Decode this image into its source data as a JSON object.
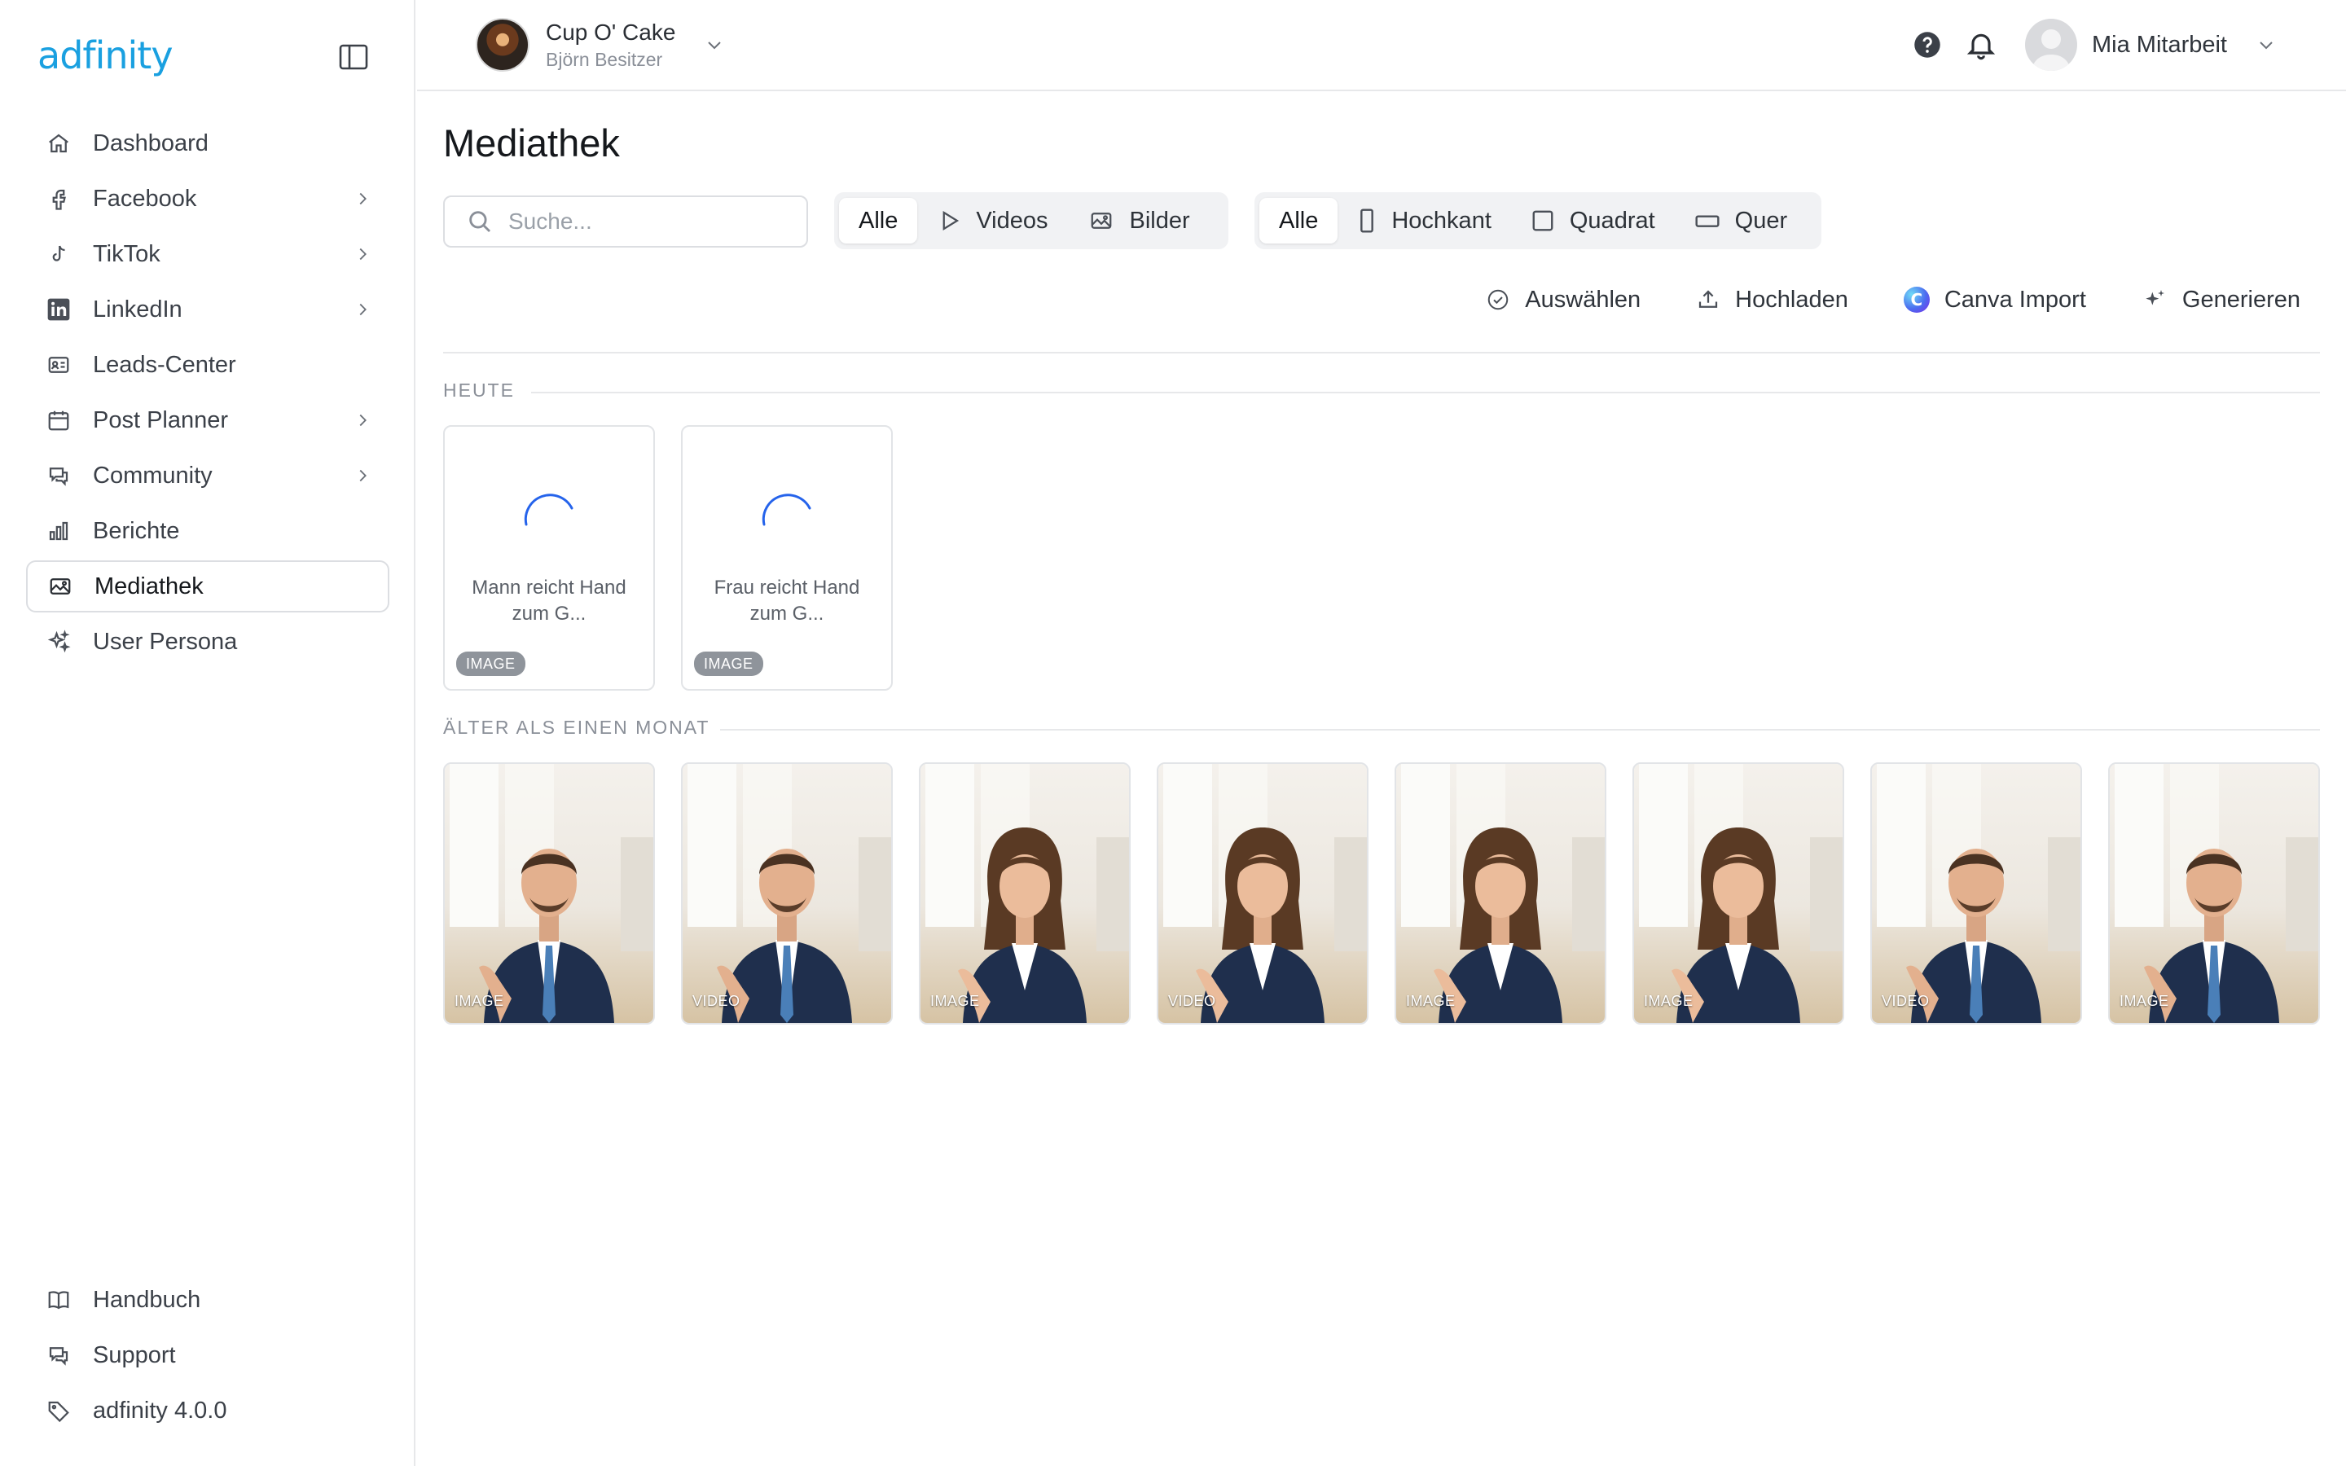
{
  "app": {
    "logo_text": "adfinity"
  },
  "sidebar": {
    "items": [
      {
        "label": "Dashboard",
        "icon": "home-icon",
        "has_submenu": false
      },
      {
        "label": "Facebook",
        "icon": "facebook-icon",
        "has_submenu": true
      },
      {
        "label": "TikTok",
        "icon": "tiktok-icon",
        "has_submenu": true
      },
      {
        "label": "LinkedIn",
        "icon": "linkedin-icon",
        "has_submenu": true
      },
      {
        "label": "Leads-Center",
        "icon": "contact-card-icon",
        "has_submenu": false
      },
      {
        "label": "Post Planner",
        "icon": "calendar-icon",
        "has_submenu": true
      },
      {
        "label": "Community",
        "icon": "chat-icon",
        "has_submenu": true
      },
      {
        "label": "Berichte",
        "icon": "bar-chart-icon",
        "has_submenu": false
      },
      {
        "label": "Mediathek",
        "icon": "image-icon",
        "has_submenu": false,
        "active": true
      },
      {
        "label": "User Persona",
        "icon": "sparkles-icon",
        "has_submenu": false
      }
    ],
    "bottom_items": [
      {
        "label": "Handbuch",
        "icon": "book-icon"
      },
      {
        "label": "Support",
        "icon": "chat-icon"
      },
      {
        "label": "adfinity 4.0.0",
        "icon": "tag-icon"
      }
    ]
  },
  "topbar": {
    "account_name": "Cup O' Cake",
    "account_owner": "Björn Besitzer",
    "user_name": "Mia Mitarbeit"
  },
  "main": {
    "title": "Mediathek",
    "search": {
      "placeholder": "Suche...",
      "value": ""
    },
    "type_filter": {
      "options": [
        "Alle",
        "Videos",
        "Bilder"
      ],
      "selected": "Alle"
    },
    "format_filter": {
      "options": [
        "Alle",
        "Hochkant",
        "Quadrat",
        "Quer"
      ],
      "selected": "Alle"
    },
    "actions": [
      "Auswählen",
      "Hochladen",
      "Canva Import",
      "Generieren"
    ],
    "sections": [
      {
        "label": "HEUTE",
        "items": [
          {
            "caption": "Mann reicht Hand zum G...",
            "type": "IMAGE",
            "loading": true
          },
          {
            "caption": "Frau reicht Hand zum G...",
            "type": "IMAGE",
            "loading": true
          }
        ]
      },
      {
        "label": "ÄLTER ALS EINEN MONAT",
        "items": [
          {
            "type": "IMAGE",
            "subject": "man"
          },
          {
            "type": "VIDEO",
            "subject": "man"
          },
          {
            "type": "IMAGE",
            "subject": "woman"
          },
          {
            "type": "VIDEO",
            "subject": "woman"
          },
          {
            "type": "IMAGE",
            "subject": "woman"
          },
          {
            "type": "IMAGE",
            "subject": "woman"
          },
          {
            "type": "VIDEO",
            "subject": "man"
          },
          {
            "type": "IMAGE",
            "subject": "man"
          }
        ]
      }
    ]
  },
  "colors": {
    "brand": "#1aa0e0",
    "spinner": "#2563eb",
    "badge": "#8f949b",
    "suit": "#1f2f4d"
  }
}
